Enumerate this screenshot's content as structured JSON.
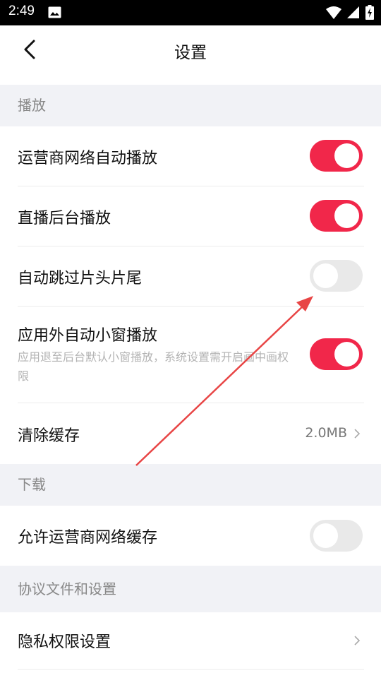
{
  "status_bar": {
    "time": "2:49"
  },
  "header": {
    "title": "设置"
  },
  "sections": {
    "play": "播放",
    "download": "下载",
    "agreement": "协议文件和设置"
  },
  "rows": {
    "carrier_autoplay": {
      "label": "运营商网络自动播放",
      "enabled": true
    },
    "live_background": {
      "label": "直播后台播放",
      "enabled": true
    },
    "skip_intro": {
      "label": "自动跳过片头片尾",
      "enabled": false
    },
    "pip": {
      "label": "应用外自动小窗播放",
      "sub": "应用退至后台默认小窗播放，系统设置需开启画中画权限",
      "enabled": true
    },
    "clear_cache": {
      "label": "清除缓存",
      "value": "2.0MB"
    },
    "carrier_cache": {
      "label": "允许运营商网络缓存",
      "enabled": false
    },
    "privacy": {
      "label": "隐私权限设置"
    }
  },
  "colors": {
    "accent": "#f1274a",
    "annotation": "#e84545"
  }
}
